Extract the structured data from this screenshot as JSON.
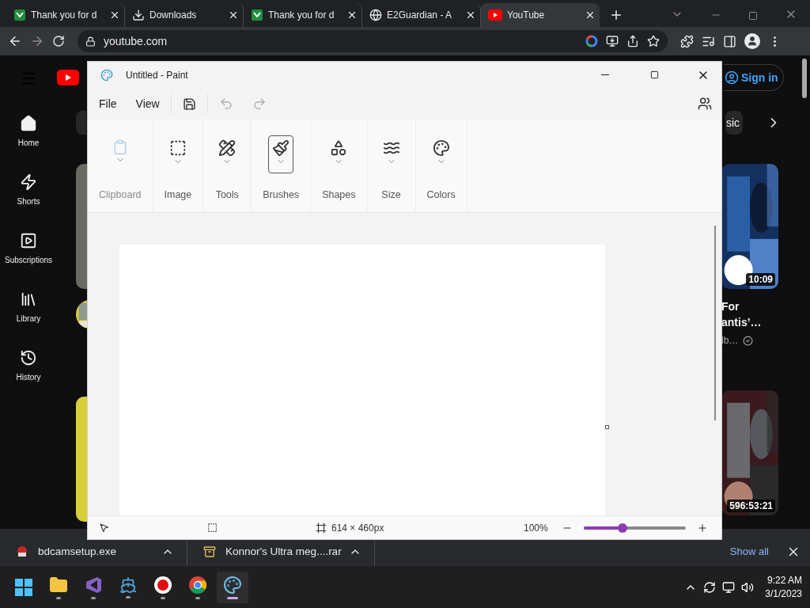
{
  "browser": {
    "tabs": [
      {
        "title": "Thank you for d",
        "kind": "sheets",
        "selected": false
      },
      {
        "title": "Downloads",
        "kind": "download",
        "selected": false
      },
      {
        "title": "Thank you for d",
        "kind": "sheets",
        "selected": false
      },
      {
        "title": "E2Guardian - A",
        "kind": "globe",
        "selected": false
      },
      {
        "title": "YouTube",
        "kind": "youtube",
        "selected": true
      }
    ],
    "address": "youtube.com"
  },
  "youtube": {
    "guide": [
      {
        "label": "Home",
        "kind": "home"
      },
      {
        "label": "Shorts",
        "kind": "shorts"
      },
      {
        "label": "Subscriptions",
        "kind": "subscriptions"
      },
      {
        "label": "Library",
        "kind": "library"
      },
      {
        "label": "History",
        "kind": "history"
      }
    ],
    "sign_in": "Sign in",
    "chip": "sic",
    "videos": [
      {
        "duration": "10:09",
        "title_lines": [
          "For",
          "antis’…"
        ],
        "channel": "lb…"
      },
      {
        "duration": "596:53:21"
      }
    ]
  },
  "paint": {
    "title": "Untitled - Paint",
    "menus": [
      "File",
      "View"
    ],
    "quick": [
      {
        "kind": "save",
        "disabled": false
      },
      {
        "kind": "undo",
        "disabled": true
      },
      {
        "kind": "redo",
        "disabled": true
      }
    ],
    "ribbon": [
      {
        "label": "Clipboard",
        "kind": "clipboard",
        "disabled": true,
        "selected": false
      },
      {
        "label": "Image",
        "disabled": false,
        "selected": false
      },
      {
        "label": "Tools",
        "kind": "tools",
        "disabled": false,
        "selected": false
      },
      {
        "label": "Brushes",
        "kind": "brushes",
        "disabled": false,
        "selected": true
      },
      {
        "label": "Shapes",
        "kind": "shapes",
        "disabled": false,
        "selected": false
      },
      {
        "label": "Size",
        "kind": "size",
        "disabled": false,
        "selected": false
      },
      {
        "label": "Colors",
        "kind": "colors",
        "disabled": false,
        "selected": false
      }
    ],
    "canvas_size": "614 × 460px",
    "zoom": "100%",
    "zoom_slider": {
      "level": 0.38
    }
  },
  "downloads": {
    "items": [
      {
        "name": "bdcamsetup.exe",
        "kind": "exe"
      },
      {
        "name": "Konnor's Ultra meg....rar",
        "kind": "rar"
      }
    ],
    "show_all": "Show all"
  },
  "taskbar": {
    "apps": [
      {
        "kind": "explorer",
        "selected": false
      },
      {
        "kind": "studio",
        "selected": false
      },
      {
        "kind": "ship",
        "selected": false
      },
      {
        "kind": "recorder",
        "selected": false
      },
      {
        "kind": "chrome",
        "selected": false
      },
      {
        "kind": "paint",
        "selected": true
      }
    ],
    "time": "9:22 AM",
    "date": "3/1/2023"
  }
}
